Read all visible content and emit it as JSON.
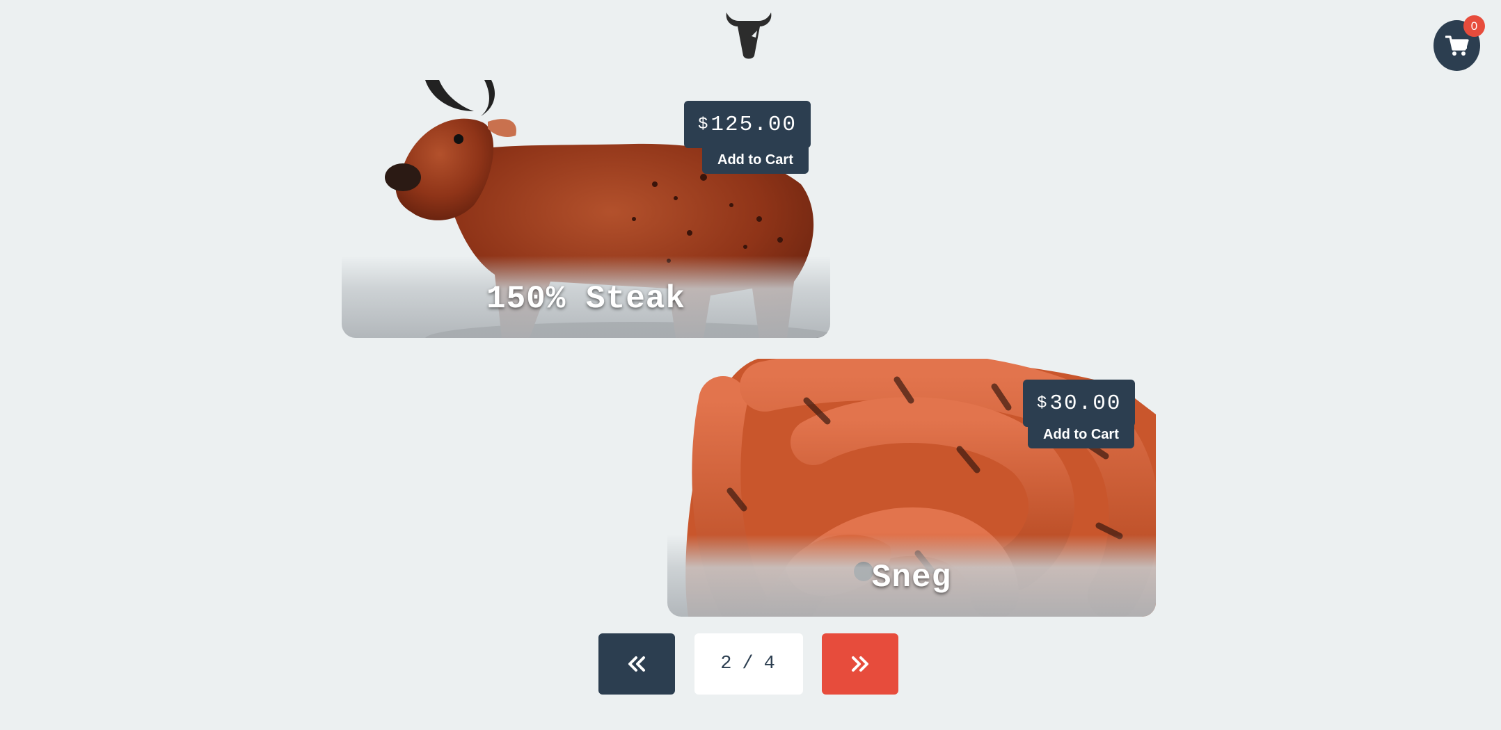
{
  "cart": {
    "count": "0",
    "icon": "cart-icon"
  },
  "logo": {
    "icon": "bull-logo-icon"
  },
  "products": [
    {
      "name": "150% Steak",
      "currency": "$",
      "price": "125.00",
      "add_label": "Add to Cart",
      "image": "bull-steak-image"
    },
    {
      "name": "Sneg",
      "currency": "$",
      "price": "30.00",
      "add_label": "Add to Cart",
      "image": "sausage-snake-image"
    }
  ],
  "pagination": {
    "current": "2",
    "separator": "/",
    "total": "4",
    "prev_icon": "double-chevron-left-icon",
    "next_icon": "double-chevron-right-icon"
  },
  "colors": {
    "background": "#ecf0f1",
    "primary": "#2c3e50",
    "accent": "#e74c3c"
  }
}
